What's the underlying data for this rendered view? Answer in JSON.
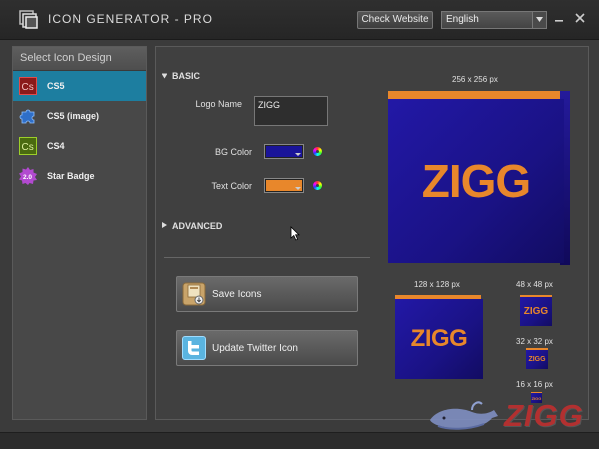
{
  "window": {
    "title": "ICON GENERATOR - PRO",
    "check_website_label": "Check Website",
    "language": "English"
  },
  "sidebar": {
    "heading": "Select Icon Design",
    "items": [
      {
        "label": "CS5",
        "icon": "cs5-icon",
        "active": true
      },
      {
        "label": "CS5 (image)",
        "icon": "puzzle-icon",
        "active": false
      },
      {
        "label": "CS4",
        "icon": "cs4-icon",
        "active": false
      },
      {
        "label": "Star Badge",
        "icon": "star-badge-icon",
        "active": false
      }
    ]
  },
  "form": {
    "basic_label": "BASIC",
    "logo_name_label": "Logo Name",
    "logo_name_value": "ZIGG",
    "bg_color_label": "BG Color",
    "bg_color": "#1a1499",
    "text_color_label": "Text Color",
    "text_color": "#e8872b",
    "advanced_label": "ADVANCED"
  },
  "actions": {
    "save_label": "Save Icons",
    "twitter_label": "Update Twitter Icon"
  },
  "previews": {
    "text": "ZIGG",
    "size_256": "256 x 256 px",
    "size_128": "128 x 128 px",
    "size_48": "48 x 48 px",
    "size_32": "32 x 32 px",
    "size_16": "16 x 16 px"
  },
  "watermark": {
    "text": "ZIGG"
  },
  "colors": {
    "accent": "#1d7ea0",
    "icon_bg": "#1a1499",
    "icon_text": "#e8872b"
  }
}
